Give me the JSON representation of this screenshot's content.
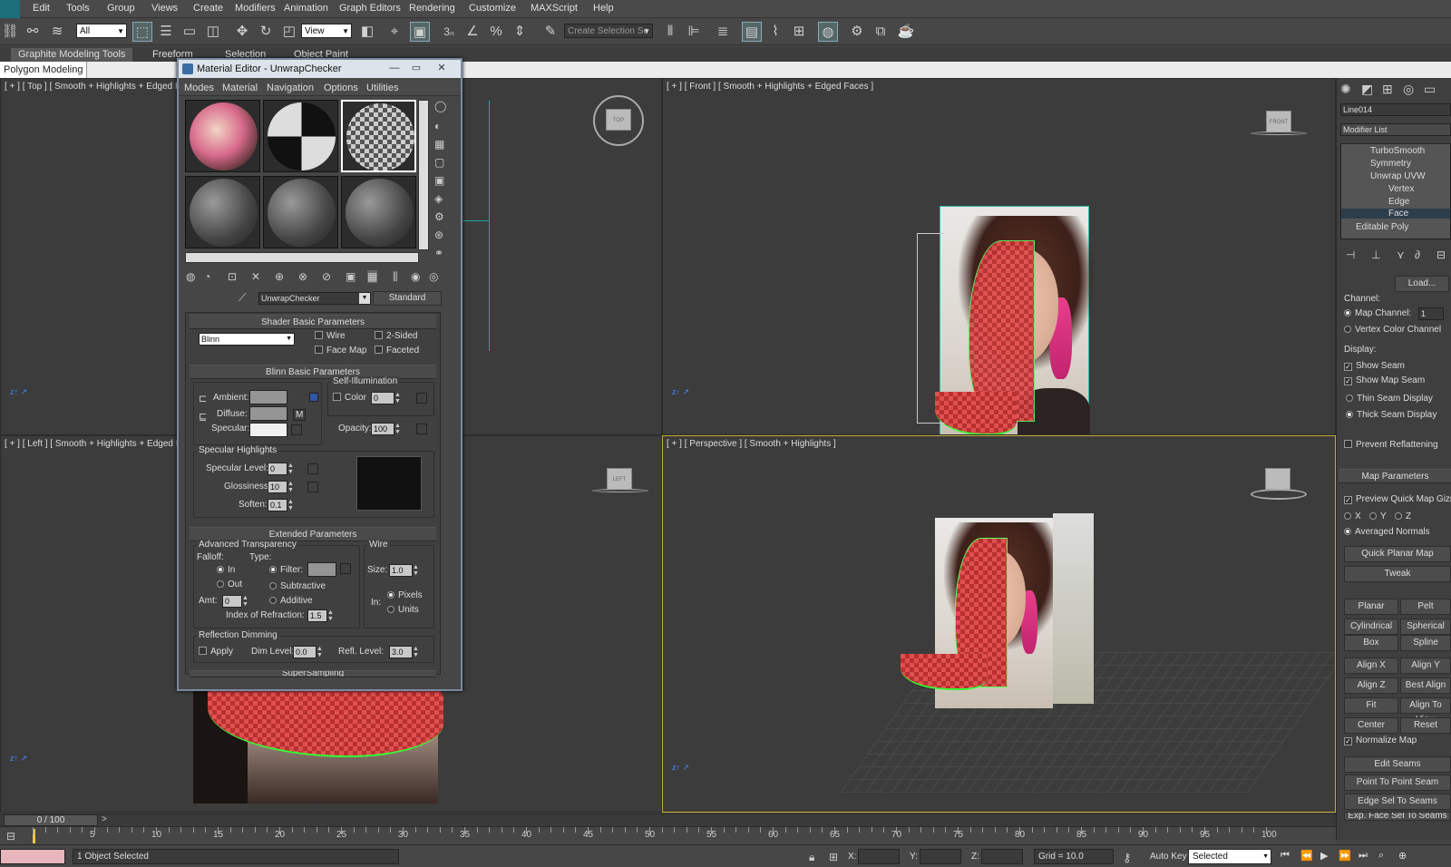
{
  "menu": [
    "Edit",
    "Tools",
    "Group",
    "Views",
    "Create",
    "Modifiers",
    "Animation",
    "Graph Editors",
    "Rendering",
    "Customize",
    "MAXScript",
    "Help"
  ],
  "toolbar": {
    "selection_filter": "All",
    "ref_coord": "View",
    "named_selection_placeholder": "Create Selection Se",
    "snap_label": "3"
  },
  "ribbon": {
    "tabs": [
      "Graphite Modeling Tools",
      "Freeform",
      "Selection",
      "Object Paint"
    ],
    "subtab": "Polygon Modeling"
  },
  "viewports": {
    "top": "[ + ] [ Top ] [ Smooth + Highlights + Edged Faces ]",
    "front": "[ + ] [ Front ] [ Smooth + Highlights + Edged Faces ]",
    "left": "[ + ] [ Left ] [ Smooth + Highlights + Edged Faces ]",
    "perspective": "[ + ] [ Perspective ] [ Smooth + Highlights ]",
    "navcube_top": "TOP",
    "navcube_front": "FRONT",
    "navcube_left": "LEFT"
  },
  "material_editor": {
    "title": "Material Editor - UnwrapChecker",
    "menu": [
      "Modes",
      "Material",
      "Navigation",
      "Options",
      "Utilities"
    ],
    "material_name": "UnwrapChecker",
    "material_type": "Standard",
    "shader_rollout": "Shader Basic Parameters",
    "shader": "Blinn",
    "wire": "Wire",
    "two_sided": "2-Sided",
    "face_map": "Face Map",
    "faceted": "Faceted",
    "blinn_rollout": "Blinn Basic Parameters",
    "self_illum": "Self-Illumination",
    "color_label": "Color",
    "color_value": "0",
    "ambient": "Ambient:",
    "diffuse": "Diffuse:",
    "specular": "Specular:",
    "m_label": "M",
    "opacity_label": "Opacity:",
    "opacity_value": "100",
    "spec_highlights": "Specular Highlights",
    "spec_level_label": "Specular Level:",
    "spec_level": "0",
    "glossiness_label": "Glossiness:",
    "glossiness": "10",
    "soften_label": "Soften:",
    "soften": "0.1",
    "extended_rollout": "Extended Parameters",
    "adv_transparency": "Advanced Transparency",
    "falloff": "Falloff:",
    "type": "Type:",
    "in": "In",
    "out": "Out",
    "filter": "Filter:",
    "subtractive": "Subtractive",
    "additive": "Additive",
    "amt_label": "Amt:",
    "amt": "0",
    "ior_label": "Index of Refraction:",
    "ior": "1.5",
    "wire_group": "Wire",
    "size_label": "Size:",
    "size": "1.0",
    "in_label": "In:",
    "pixels": "Pixels",
    "units": "Units",
    "reflection_dimming": "Reflection Dimming",
    "apply": "Apply",
    "dim_level_label": "Dim Level:",
    "dim_level": "0.0",
    "refl_level_label": "Refl. Level:",
    "refl_level": "3.0",
    "supersampling": "SuperSampling"
  },
  "command_panel": {
    "object_name": "Line014",
    "modifier_list": "Modifier List",
    "stack": [
      "TurboSmooth",
      "Symmetry",
      "Unwrap UVW",
      "Vertex",
      "Edge",
      "Face",
      "Editable Poly"
    ],
    "load": "Load...",
    "channel": "Channel:",
    "map_channel": "Map Channel:",
    "map_channel_value": "1",
    "vertex_color_channel": "Vertex Color Channel",
    "display": "Display:",
    "show_seam": "Show Seam",
    "show_map_seam": "Show Map Seam",
    "thin_seam": "Thin Seam Display",
    "thick_seam": "Thick Seam Display",
    "prevent_reflattening": "Prevent Reflattening",
    "map_parameters": "Map Parameters",
    "preview_quick_map": "Preview Quick Map Gizmo",
    "x": "X",
    "y": "Y",
    "z": "Z",
    "averaged_normals": "Averaged Normals",
    "quick_planar_map": "Quick Planar Map",
    "tweak": "Tweak",
    "planar": "Planar",
    "pelt": "Pelt",
    "cylindrical": "Cylindrical",
    "spherical": "Spherical",
    "box": "Box",
    "spline": "Spline",
    "align_x": "Align X",
    "align_y": "Align Y",
    "align_z": "Align Z",
    "best_align": "Best Align",
    "fit": "Fit",
    "align_to_view": "Align To View",
    "center": "Center",
    "reset": "Reset",
    "normalize_map": "Normalize Map",
    "edit_seams": "Edit Seams",
    "point_to_point_seam": "Point To Point Seam",
    "edge_sel_to_seams": "Edge Sel To Seams",
    "exp_face_sel": "Exp. Face Sel To Seams"
  },
  "timeline": {
    "frame": "0 / 100",
    "next": ">",
    "ticks": [
      "5",
      "10",
      "15",
      "20",
      "25",
      "30",
      "35",
      "40",
      "45",
      "50",
      "55",
      "60",
      "65",
      "70",
      "75",
      "80",
      "85",
      "90",
      "95",
      "100"
    ]
  },
  "status": {
    "selected": "1 Object Selected",
    "x_label": "X:",
    "y_label": "Y:",
    "z_label": "Z:",
    "grid": "Grid = 10.0",
    "auto_key": "Auto Key",
    "selected_dropdown": "Selected"
  }
}
